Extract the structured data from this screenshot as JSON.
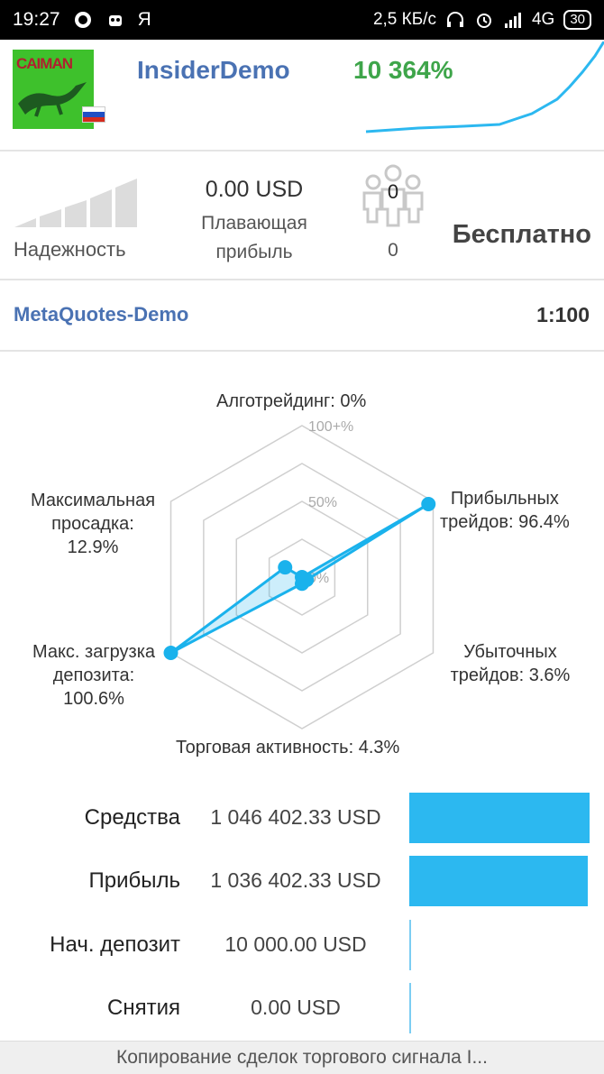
{
  "status_bar": {
    "time": "19:27",
    "carrier_glyph": "Я",
    "network_speed": "2,5 КБ/с",
    "network_type": "4G",
    "battery": "30"
  },
  "signal": {
    "name": "InsiderDemo",
    "gain": "10 364%",
    "logo_text": "CAIMAN",
    "flag": "russia-flag"
  },
  "stats_top": {
    "reliability_label": "Надежность",
    "floating_profit_value": "0.00 USD",
    "floating_profit_label_line1": "Плавающая",
    "floating_profit_label_line2": "прибыль",
    "subscribers_count": "0",
    "subscribers_zero": "0",
    "price": "Бесплатно",
    "reliability_level": 0
  },
  "account": {
    "server": "MetaQuotes-Demo",
    "leverage": "1:100"
  },
  "radar": {
    "scale_max": "100+%",
    "scale_mid": "50%",
    "scale_min": "0%",
    "labels": {
      "algo": "Алготрейдинг: 0%",
      "profit_trades_1": "Прибыльных",
      "profit_trades_2": "трейдов: 96.4%",
      "loss_trades_1": "Убыточных",
      "loss_trades_2": "трейдов: 3.6%",
      "activity": "Торговая активность: 4.3%",
      "deposit_load_1": "Макс. загрузка",
      "deposit_load_2": "депозита:",
      "deposit_load_3": "100.6%",
      "drawdown_1": "Максимальная",
      "drawdown_2": "просадка:",
      "drawdown_3": "12.9%"
    },
    "values": {
      "algo": 0,
      "profit_trades": 96.4,
      "loss_trades": 3.6,
      "activity": 4.3,
      "deposit_load": 100.6,
      "drawdown": 12.9
    },
    "accent": "#1ab2ec"
  },
  "balances": [
    {
      "label": "Средства",
      "value": "1 046 402.33 USD",
      "fill": 1.0
    },
    {
      "label": "Прибыль",
      "value": "1 036 402.33 USD",
      "fill": 0.99
    },
    {
      "label": "Нач. депозит",
      "value": "10 000.00 USD",
      "fill": 0.0
    },
    {
      "label": "Снятия",
      "value": "0.00 USD",
      "fill": 0.0
    }
  ],
  "footer": {
    "text": "Копирование сделок торгового сигнала I..."
  }
}
